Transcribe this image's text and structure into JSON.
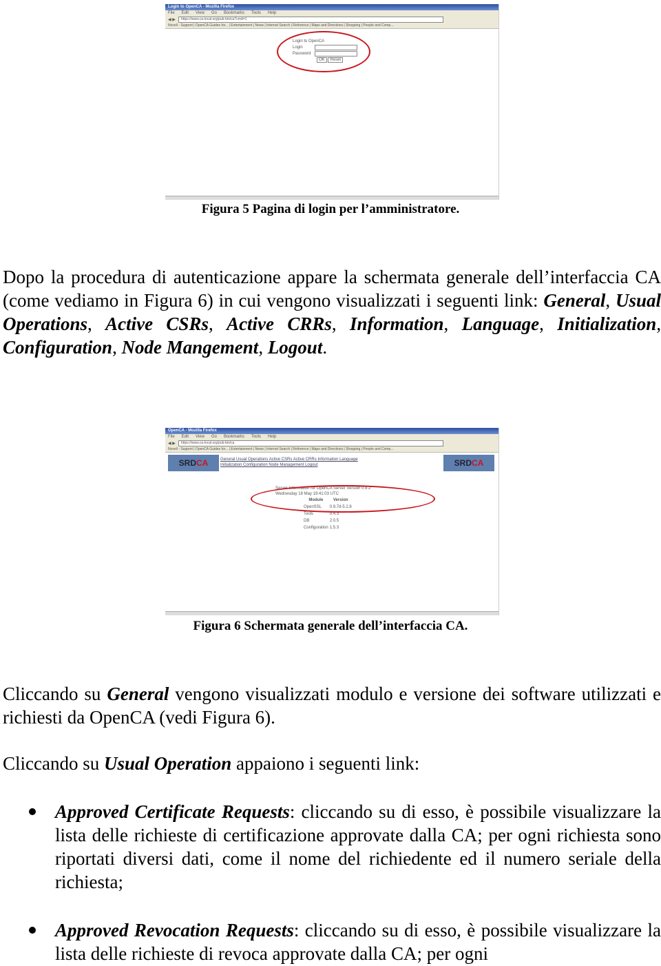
{
  "figure5": {
    "window_title": "Login to OpenCA - Mozilla Firefox",
    "menu": [
      "File",
      "Edit",
      "View",
      "Go",
      "Bookmarks",
      "Tools",
      "Help"
    ],
    "url": "https://www.ca-local.org/pub-bin/ca?cmd=1",
    "bookmarks": "Novell - Support | OpenCA Guides for... | Entertainment | News | Internet Search | Reference | Maps and Directions | Shopping | People and Comp...",
    "form_title": "Login to OpenCA",
    "login_label": "Login",
    "password_label": "Password",
    "ok_label": "OK",
    "reset_label": "Reset",
    "caption": "Figura 5 Pagina di login per l’amministratore."
  },
  "paragraph1": {
    "text1": "Dopo la procedura di autenticazione appare la schermata generale dell’interfaccia CA (come vediamo in Figura 6) in cui vengono visualizzati i seguenti link: ",
    "links": [
      "General",
      "Usual Operations",
      "Active CSRs",
      "Active CRRs",
      "Information",
      "Language",
      "Initialization",
      "Configuration",
      "Node Mangement",
      "Logout"
    ]
  },
  "figure6": {
    "window_title": "OpenCA - Mozilla Firefox",
    "url": "https://www.ca-local.org/pub-bin/ca",
    "logo": "SRD",
    "logo_accent": "CA",
    "nav_line1": "General Usual Operations Active CSRs Active CRRs Information Language",
    "nav_line2": "Initialization Configuration Node Management Logout",
    "info_title": "Server Information for OpenCA Server Version 0.9.2",
    "info_date": "Wednesday 18 May 19:41:03 UTC",
    "table_headers": [
      "Module",
      "Version"
    ],
    "table_rows": [
      [
        "OpenSSL",
        "0.9.7d-5.2.8"
      ],
      [
        "Tools",
        "0.4.3"
      ],
      [
        "DB",
        "2.0.5"
      ],
      [
        "Configuration",
        "1.5.3"
      ]
    ],
    "caption": "Figura 6  Schermata generale dell’interfaccia CA."
  },
  "paragraph2": {
    "pre": "Cliccando su ",
    "link": "General",
    "post": " vengono visualizzati modulo e versione dei software utilizzati e richiesti da OpenCA (vedi Figura 6)."
  },
  "paragraph3": {
    "pre": "Cliccando su ",
    "link": "Usual Operation",
    "post": " appaiono i seguenti link:"
  },
  "bullets": [
    {
      "title": "Approved Certificate Requests",
      "text": ": cliccando su di esso, è possibile visualizzare la lista delle richieste di certificazione approvate dalla CA; per ogni richiesta sono riportati diversi dati, come il nome del richiedente ed il numero seriale della richiesta;"
    },
    {
      "title": "Approved Revocation Requests",
      "text": ": cliccando su di esso, è possibile visualizzare la lista delle richieste di revoca approvate dalla CA; per ogni"
    }
  ],
  "colors": {
    "annotation": "#c8161d",
    "titlebar": "#2a4fa0"
  }
}
